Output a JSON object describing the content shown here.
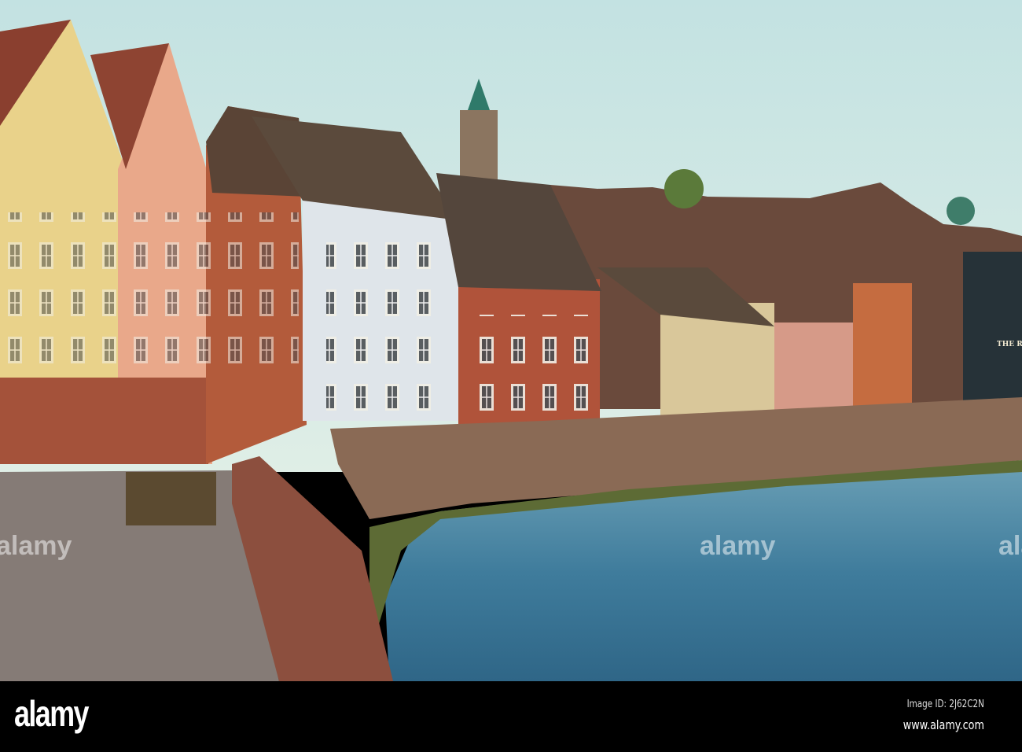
{
  "photo": {
    "subject": "Riverside terraced houses with river quay",
    "pub_sign": "THE RI",
    "watermarks": [
      "alamy",
      "alamy",
      "alamy"
    ]
  },
  "footer": {
    "logo": "alamy",
    "image_id": "Image ID: 2J62C2N",
    "website": "www.alamy.com"
  },
  "colors": {
    "sky": "#cfe6e4",
    "water": "#3f7f9e",
    "brick": "#a8553a",
    "footer": "#000000"
  }
}
